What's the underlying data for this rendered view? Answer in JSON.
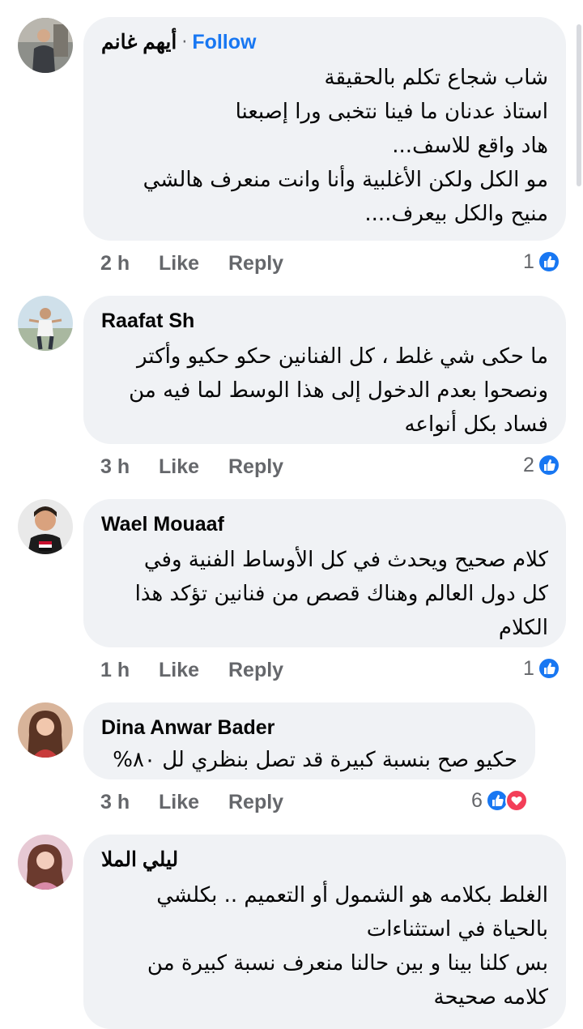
{
  "comments": [
    {
      "author": "أيهم غانم",
      "follow": "Follow",
      "dot": "·",
      "lines": [
        "شاب شجاع تكلم بالحقيقة",
        "استاذ عدنان ما فينا نتخبى ورا إصبعنا",
        "هاد واقع للاسف...",
        "مو الكل ولكن الأغلبية وأنا وانت منعرف هالشي",
        "منيح والكل بيعرف...."
      ],
      "time": "2 h",
      "like": "Like",
      "reply": "Reply",
      "reactions": "1"
    },
    {
      "author": "Raafat Sh",
      "lines": [
        "ما حكى شي غلط ، كل الفنانين حكو حكيو وأكتر",
        "ونصحوا بعدم الدخول إلى هذا الوسط لما فيه من",
        "فساد بكل أنواعه"
      ],
      "time": "3 h",
      "like": "Like",
      "reply": "Reply",
      "reactions": "2"
    },
    {
      "author": "Wael Mouaaf",
      "lines": [
        "كلام صحيح ويحدث في كل الأوساط الفنية وفي",
        "كل دول العالم وهناك قصص من فنانين تؤكد هذا",
        "الكلام"
      ],
      "time": "1 h",
      "like": "Like",
      "reply": "Reply",
      "reactions": "1"
    },
    {
      "author": "Dina Anwar Bader",
      "lines": [
        "حكيو صح بنسبة كبيرة قد تصل بنظري لل ٨٠%"
      ],
      "time": "3 h",
      "like": "Like",
      "reply": "Reply",
      "reactions": "6"
    },
    {
      "author": "ليلي الملا",
      "lines": [
        "الغلط بكلامه هو الشمول أو التعميم .. بكلشي",
        "بالحياة في استثناءات",
        "بس كلنا بينا و بين حالنا منعرف نسبة كبيرة من",
        "كلامه صحيحة"
      ]
    }
  ],
  "icons": {
    "like": "like-reaction-icon",
    "love": "love-reaction-icon"
  },
  "colors": {
    "accent": "#1877f2",
    "bubble": "#f0f2f5",
    "love": "#f33e58",
    "meta": "#65676b"
  }
}
